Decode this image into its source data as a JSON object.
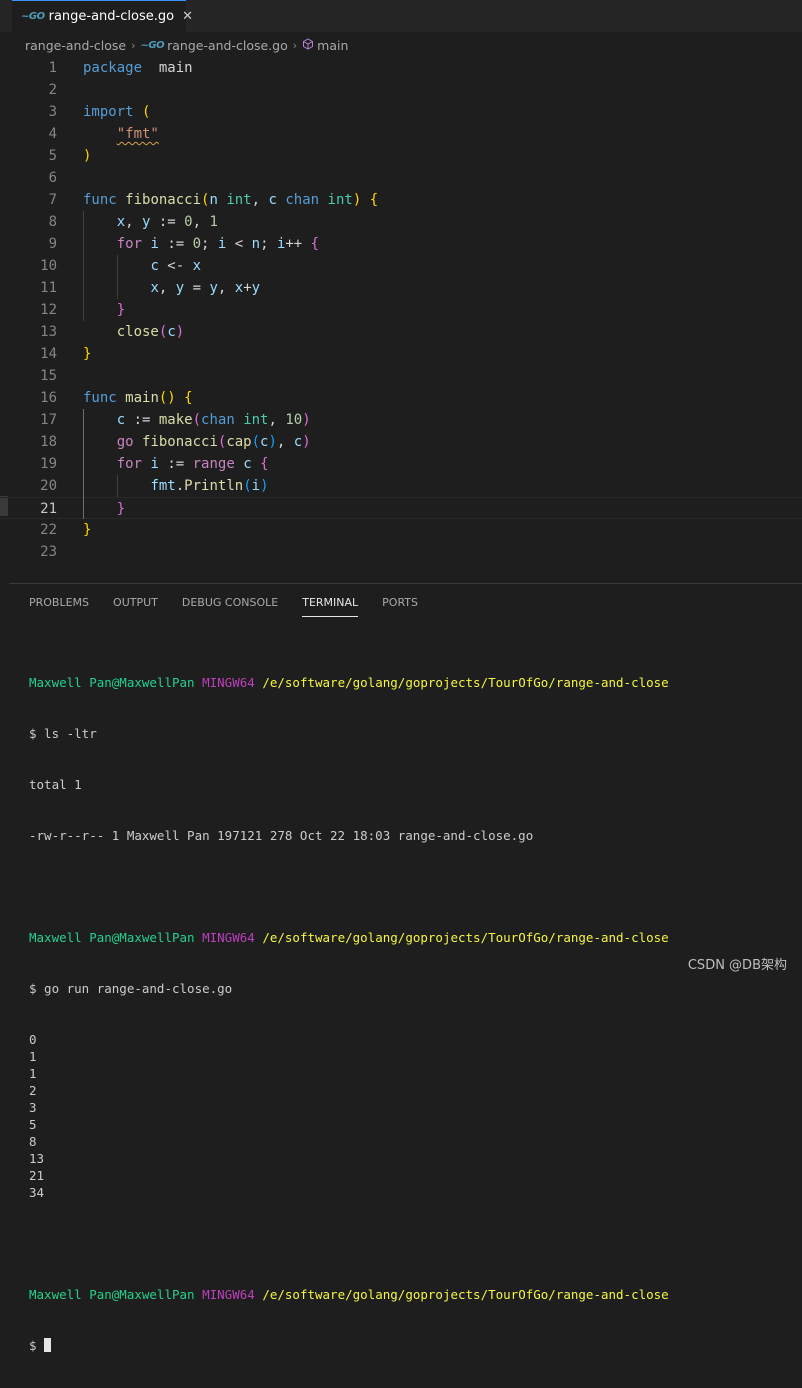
{
  "tab": {
    "title": "range-and-close.go",
    "icon": "go-file-icon",
    "close_glyph": "✕"
  },
  "breadcrumb": {
    "folder": "range-and-close",
    "file": "range-and-close.go",
    "symbol": "main"
  },
  "editor": {
    "line_numbers": [
      "1",
      "2",
      "3",
      "4",
      "5",
      "6",
      "7",
      "8",
      "9",
      "10",
      "11",
      "12",
      "13",
      "14",
      "15",
      "16",
      "17",
      "18",
      "19",
      "20",
      "21",
      "22",
      "23"
    ],
    "current_line": "21",
    "lines": [
      [
        [
          "k",
          "package"
        ],
        [
          "",
          "  main"
        ]
      ],
      [],
      [
        [
          "k",
          "import"
        ],
        [
          "",
          " "
        ],
        [
          "b1",
          "("
        ]
      ],
      [
        [
          "",
          "    "
        ],
        [
          "s",
          "\"fmt\""
        ]
      ],
      [
        [
          "b1",
          ")"
        ]
      ],
      [],
      [
        [
          "k",
          "func"
        ],
        [
          "",
          " "
        ],
        [
          "f",
          "fibonacci"
        ],
        [
          "b1",
          "("
        ],
        [
          "v",
          "n"
        ],
        [
          "",
          " "
        ],
        [
          "t",
          "int"
        ],
        [
          "",
          ", "
        ],
        [
          "v",
          "c"
        ],
        [
          "",
          " "
        ],
        [
          "k",
          "chan"
        ],
        [
          "",
          " "
        ],
        [
          "t",
          "int"
        ],
        [
          "b1",
          ")"
        ],
        [
          "",
          " "
        ],
        [
          "b1",
          "{"
        ]
      ],
      [
        [
          "",
          "    "
        ],
        [
          "v",
          "x"
        ],
        [
          "",
          ", "
        ],
        [
          "v",
          "y"
        ],
        [
          "",
          " := "
        ],
        [
          "n",
          "0"
        ],
        [
          "",
          ", "
        ],
        [
          "n",
          "1"
        ]
      ],
      [
        [
          "",
          "    "
        ],
        [
          "c",
          "for"
        ],
        [
          "",
          " "
        ],
        [
          "v",
          "i"
        ],
        [
          "",
          " := "
        ],
        [
          "n",
          "0"
        ],
        [
          "",
          "; "
        ],
        [
          "v",
          "i"
        ],
        [
          "",
          " < "
        ],
        [
          "v",
          "n"
        ],
        [
          "",
          "; "
        ],
        [
          "v",
          "i"
        ],
        [
          "",
          "++ "
        ],
        [
          "b2",
          "{"
        ]
      ],
      [
        [
          "",
          "        "
        ],
        [
          "v",
          "c"
        ],
        [
          "",
          " <- "
        ],
        [
          "v",
          "x"
        ]
      ],
      [
        [
          "",
          "        "
        ],
        [
          "v",
          "x"
        ],
        [
          "",
          ", "
        ],
        [
          "v",
          "y"
        ],
        [
          "",
          " = "
        ],
        [
          "v",
          "y"
        ],
        [
          "",
          ", "
        ],
        [
          "v",
          "x"
        ],
        [
          "",
          "+"
        ],
        [
          "v",
          "y"
        ]
      ],
      [
        [
          "",
          "    "
        ],
        [
          "b2",
          "}"
        ]
      ],
      [
        [
          "",
          "    "
        ],
        [
          "f",
          "close"
        ],
        [
          "b2",
          "("
        ],
        [
          "v",
          "c"
        ],
        [
          "b2",
          ")"
        ]
      ],
      [
        [
          "b1",
          "}"
        ]
      ],
      [],
      [
        [
          "k",
          "func"
        ],
        [
          "",
          " "
        ],
        [
          "f",
          "main"
        ],
        [
          "b1",
          "()"
        ],
        [
          "",
          " "
        ],
        [
          "b1",
          "{"
        ]
      ],
      [
        [
          "",
          "    "
        ],
        [
          "v",
          "c"
        ],
        [
          "",
          " := "
        ],
        [
          "f",
          "make"
        ],
        [
          "b2",
          "("
        ],
        [
          "k",
          "chan"
        ],
        [
          "",
          " "
        ],
        [
          "t",
          "int"
        ],
        [
          "",
          ", "
        ],
        [
          "n",
          "10"
        ],
        [
          "b2",
          ")"
        ]
      ],
      [
        [
          "",
          "    "
        ],
        [
          "c",
          "go"
        ],
        [
          "",
          " "
        ],
        [
          "f",
          "fibonacci"
        ],
        [
          "b2",
          "("
        ],
        [
          "f",
          "cap"
        ],
        [
          "b3",
          "("
        ],
        [
          "v",
          "c"
        ],
        [
          "b3",
          ")"
        ],
        [
          "",
          ", "
        ],
        [
          "v",
          "c"
        ],
        [
          "b2",
          ")"
        ]
      ],
      [
        [
          "",
          "    "
        ],
        [
          "c",
          "for"
        ],
        [
          "",
          " "
        ],
        [
          "v",
          "i"
        ],
        [
          "",
          " := "
        ],
        [
          "c",
          "range"
        ],
        [
          "",
          " "
        ],
        [
          "v",
          "c"
        ],
        [
          "",
          " "
        ],
        [
          "b2",
          "{"
        ]
      ],
      [
        [
          "",
          "        "
        ],
        [
          "v",
          "fmt"
        ],
        [
          "",
          "."
        ],
        [
          "f",
          "Println"
        ],
        [
          "b3",
          "("
        ],
        [
          "v",
          "i"
        ],
        [
          "b3",
          ")"
        ]
      ],
      [
        [
          "",
          "    "
        ],
        [
          "b2",
          "}"
        ]
      ],
      [
        [
          "b1",
          "}"
        ]
      ],
      []
    ]
  },
  "panel": {
    "tabs": [
      "PROBLEMS",
      "OUTPUT",
      "DEBUG CONSOLE",
      "TERMINAL",
      "PORTS"
    ],
    "active_tab": "TERMINAL"
  },
  "terminal": {
    "user": "Maxwell Pan@MaxwellPan",
    "env": "MINGW64",
    "path": "/e/software/golang/goprojects/TourOfGo/range-and-close",
    "cmd1": "$ ls -ltr",
    "ls_total": "total 1",
    "ls_entry": "-rw-r--r-- 1 Maxwell Pan 197121 278 Oct 22 18:03 range-and-close.go",
    "cmd2": "$ go run range-and-close.go",
    "output": [
      "0",
      "1",
      "1",
      "2",
      "3",
      "5",
      "8",
      "13",
      "21",
      "34"
    ],
    "prompt": "$ "
  },
  "watermark": "CSDN @DB架构"
}
